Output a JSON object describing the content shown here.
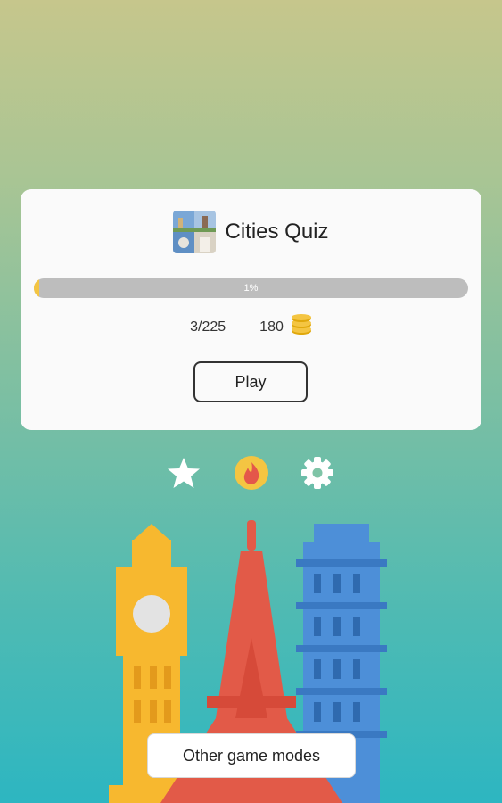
{
  "quiz": {
    "title": "Cities Quiz",
    "progress_label": "1%",
    "progress_fraction": 0.01,
    "answered": "3/225",
    "coins": "180",
    "play_label": "Play"
  },
  "actions": {
    "favorites_icon": "star-icon",
    "hot_icon": "fire-icon",
    "settings_icon": "gear-icon"
  },
  "other_modes_label": "Other game modes",
  "colors": {
    "card_bg": "#fafafa",
    "progress_track": "#bdbdbd",
    "progress_fill": "#f4c542",
    "coin": "#f4c542",
    "fire_badge": "#f4c542",
    "fire_flame": "#e4574a",
    "big_ben": "#f7b82f",
    "eiffel": "#e25a48",
    "pisa": "#4d8fd8"
  }
}
